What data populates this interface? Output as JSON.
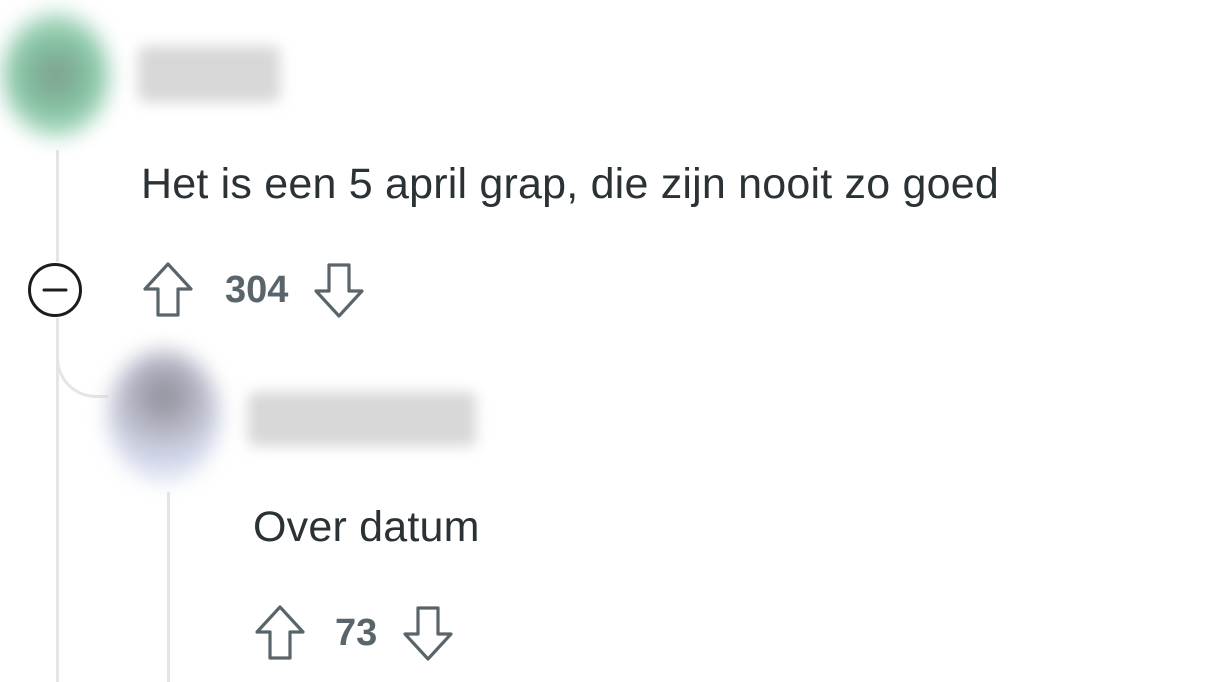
{
  "comments": [
    {
      "author": "",
      "text": "Het is een 5 april grap, die zijn nooit zo goed",
      "score": "304"
    },
    {
      "author": "",
      "text": "Over datum",
      "score": "73"
    }
  ],
  "icons": {
    "upvote": "arrow-up-outline-icon",
    "downvote": "arrow-down-outline-icon",
    "collapse": "minus-circle-icon"
  },
  "colors": {
    "text": "#2a3236",
    "score": "#5a656b",
    "icon": "#5a656b",
    "thread_line": "#e3e5e6"
  }
}
